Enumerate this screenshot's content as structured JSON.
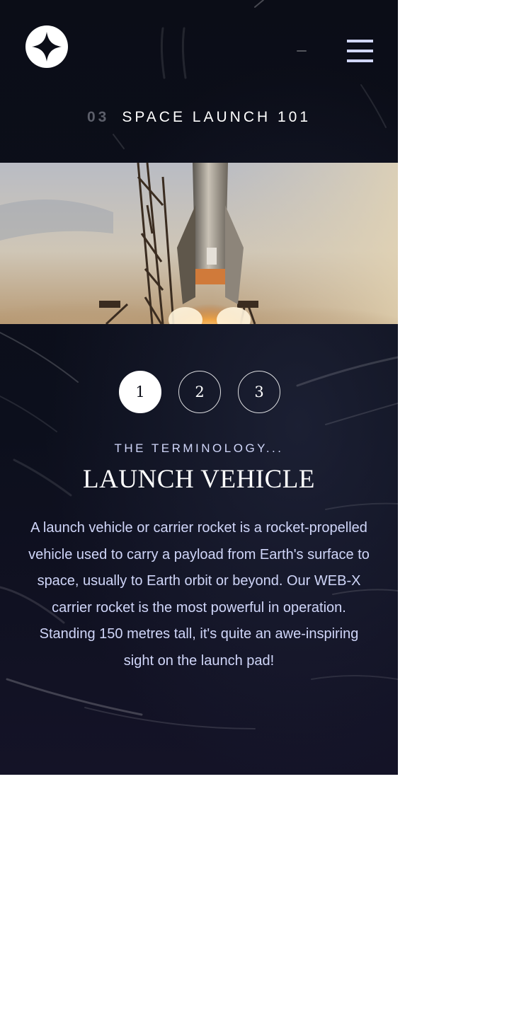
{
  "header": {
    "logo_icon": "star-logo-icon",
    "menu_icon": "hamburger-menu-icon"
  },
  "heading": {
    "number": "03",
    "label": "SPACE LAUNCH 101"
  },
  "hero": {
    "image_subject": "rocket-launch-image"
  },
  "pager": {
    "items": [
      "1",
      "2",
      "3"
    ],
    "active_index": 0
  },
  "content": {
    "eyebrow": "THE TERMINOLOGY...",
    "title": "LAUNCH VEHICLE",
    "body": "A launch vehicle or carrier rocket is a rocket-propelled vehicle used to carry a payload from Earth's surface to space, usually to Earth orbit or beyond. Our WEB-X carrier rocket is the most powerful in operation. Standing 150 metres tall, it's quite an awe-inspiring sight on the launch pad!"
  },
  "colors": {
    "background": "#0b0d17",
    "accent_light": "#d0d6f9",
    "white": "#ffffff",
    "muted": "#5c5f6a"
  }
}
